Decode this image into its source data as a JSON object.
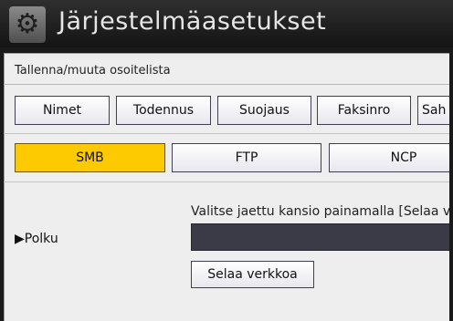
{
  "window": {
    "title": "Järjestelmäasetukset",
    "icon": "gear-icon"
  },
  "section": {
    "title": "Tallenna/muuta osoitelista"
  },
  "tabs": [
    {
      "label": "Nimet"
    },
    {
      "label": "Todennus"
    },
    {
      "label": "Suojaus"
    },
    {
      "label": "Faksinro"
    },
    {
      "label": "Sah"
    }
  ],
  "protocols": [
    {
      "label": "SMB",
      "selected": true
    },
    {
      "label": "FTP",
      "selected": false
    },
    {
      "label": "NCP",
      "selected": false
    }
  ],
  "path": {
    "label": "Polku",
    "instruction": "Valitse jaettu kansio painamalla [Selaa verk",
    "value": "",
    "browse_label": "Selaa verkkoa"
  },
  "colors": {
    "selected": "#fdc900",
    "field": "#3b3b48",
    "titlebar": "#1a1a1a"
  }
}
